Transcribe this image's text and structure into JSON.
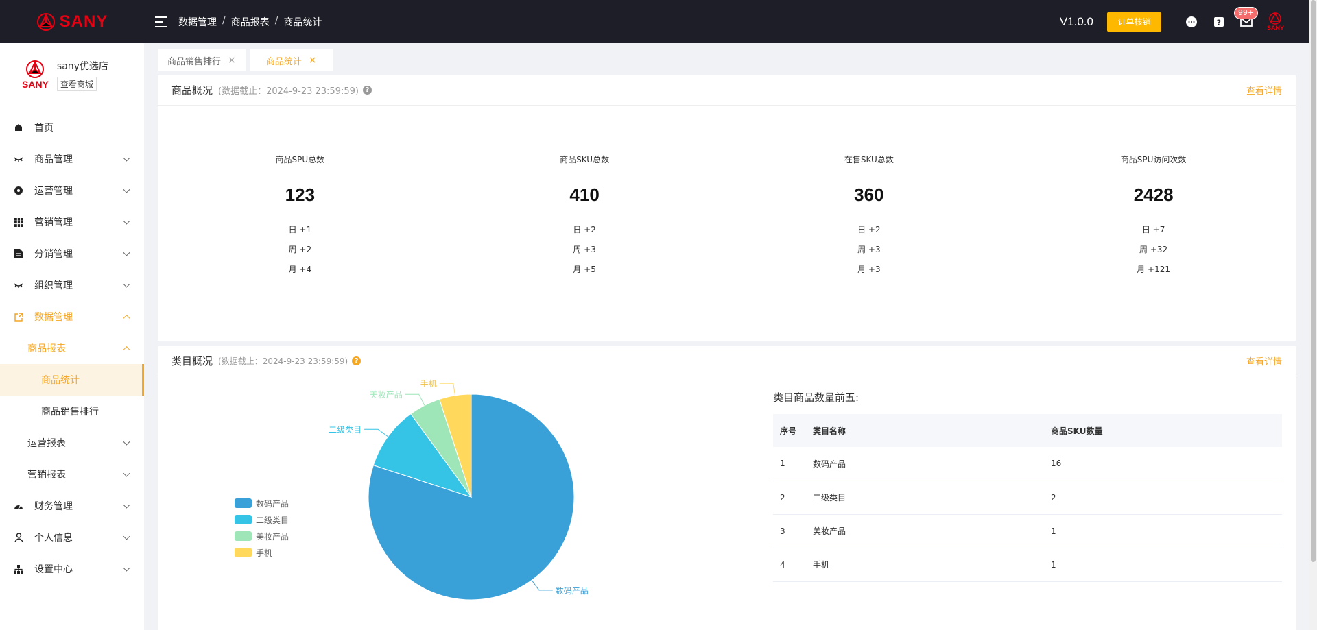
{
  "header": {
    "brand": "SANY",
    "breadcrumb": [
      "数据管理",
      "商品报表",
      "商品统计"
    ],
    "version": "V1.0.0",
    "verify_button": "订单核销",
    "badge": "99+",
    "logo_small": "SANY"
  },
  "sidebar": {
    "shop_name": "sany优选店",
    "shop_link": "查看商城",
    "logo_text": "SANY",
    "items": [
      {
        "label": "首页"
      },
      {
        "label": "商品管理"
      },
      {
        "label": "运营管理"
      },
      {
        "label": "营销管理"
      },
      {
        "label": "分销管理"
      },
      {
        "label": "组织管理"
      },
      {
        "label": "数据管理"
      },
      {
        "label": "商品报表"
      },
      {
        "label": "商品统计"
      },
      {
        "label": "商品销售排行"
      },
      {
        "label": "运营报表"
      },
      {
        "label": "营销报表"
      },
      {
        "label": "财务管理"
      },
      {
        "label": "个人信息"
      },
      {
        "label": "设置中心"
      }
    ]
  },
  "tabs": [
    {
      "label": "商品销售排行",
      "close": "×"
    },
    {
      "label": "商品统计",
      "close": "×"
    }
  ],
  "overview": {
    "title": "商品概况",
    "subtitle": "(数据截止：2024-9-23 23:59:59)",
    "detail": "查看详情",
    "stats": [
      {
        "label": "商品SPU总数",
        "value": "123",
        "day": "日 +1",
        "week": "周 +2",
        "month": "月 +4"
      },
      {
        "label": "商品SKU总数",
        "value": "410",
        "day": "日 +2",
        "week": "周 +3",
        "month": "月 +5"
      },
      {
        "label": "在售SKU总数",
        "value": "360",
        "day": "日 +2",
        "week": "周 +3",
        "month": "月 +3"
      },
      {
        "label": "商品SPU访问次数",
        "value": "2428",
        "day": "日 +7",
        "week": "周 +32",
        "month": "月 +121"
      }
    ]
  },
  "category": {
    "title": "类目概况",
    "subtitle": "(数据截止：2024-9-23 23:59:59)",
    "detail": "查看详情",
    "table_title": "类目商品数量前五:",
    "columns": [
      "序号",
      "类目名称",
      "商品SKU数量"
    ],
    "rows": [
      [
        "1",
        "数码产品",
        "16"
      ],
      [
        "2",
        "二级类目",
        "2"
      ],
      [
        "3",
        "美妆产品",
        "1"
      ],
      [
        "4",
        "手机",
        "1"
      ]
    ]
  },
  "chart_data": {
    "type": "pie",
    "categories": [
      "数码产品",
      "二级类目",
      "美妆产品",
      "手机"
    ],
    "values": [
      16,
      2,
      1,
      1
    ],
    "colors": [
      "#3aa1d8",
      "#35c3e6",
      "#9ee6b8",
      "#ffd85c"
    ],
    "legend_position": "left"
  }
}
